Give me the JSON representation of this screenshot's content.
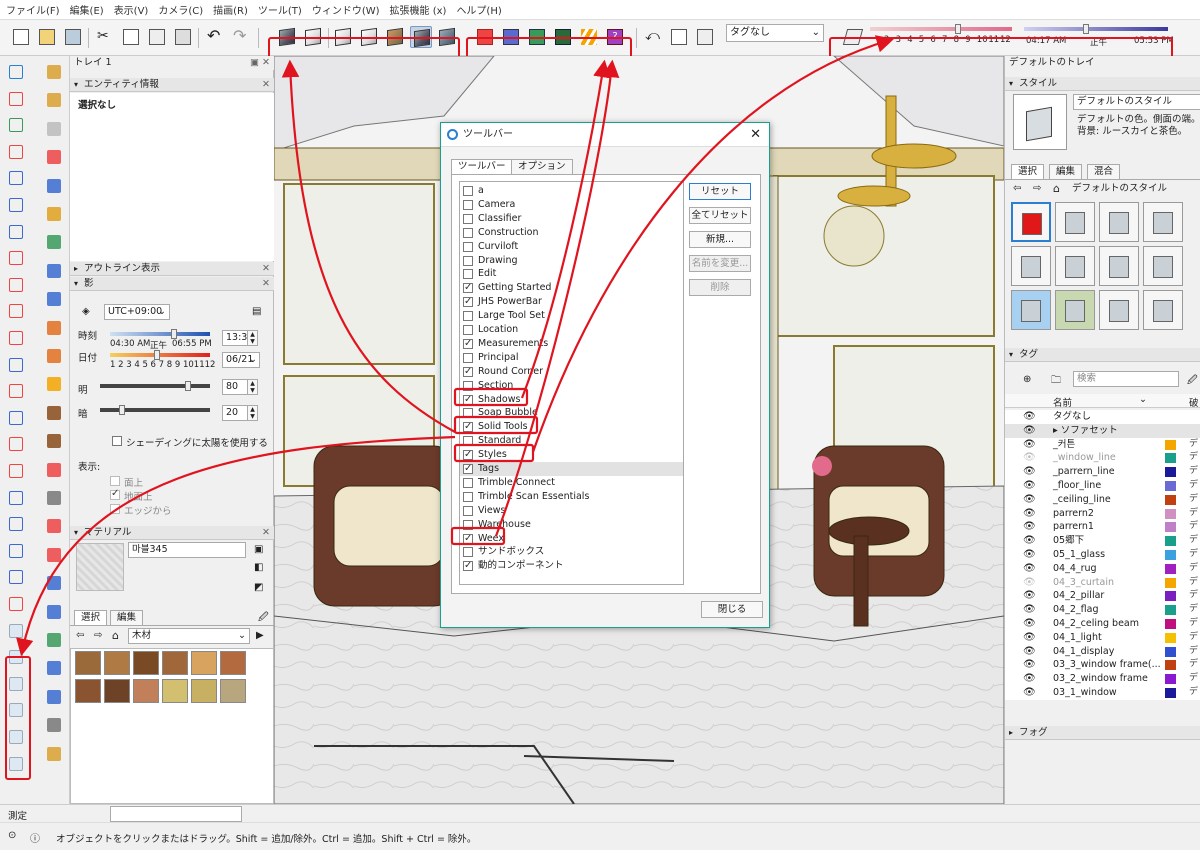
{
  "menu": [
    "ファイル(F)",
    "編集(E)",
    "表示(V)",
    "カメラ(C)",
    "描画(R)",
    "ツール(T)",
    "ウィンドウ(W)",
    "拡張機能 (x)",
    "ヘルプ(H)"
  ],
  "toolbar": {
    "tag_dropdown": "タグなし",
    "months": [
      "2",
      "3",
      "4",
      "5",
      "6",
      "7",
      "8",
      "9",
      "10",
      "11",
      "12"
    ],
    "time_start": "04:17 AM",
    "time_noon": "正午",
    "time_end": "05:53 PM"
  },
  "tray": {
    "title": "トレイ 1",
    "entity_info": {
      "header": "エンティティ情報",
      "selection": "選択なし"
    },
    "outliner": {
      "header": "アウトライン表示"
    },
    "shadows": {
      "header": "影",
      "timezone": "UTC+09:00",
      "time_label": "時刻",
      "time_start": "04:30 AM",
      "time_noon": "正午",
      "time_end": "06:55 PM",
      "time_value": "13:30",
      "date_label": "日付",
      "date_months": "1 2 3 4 5 6 7 8 9 101112",
      "date_value": "06/21",
      "light_label": "明",
      "light_value": "80",
      "light_level": 80,
      "dark_label": "暗",
      "dark_value": "20",
      "dark_level": 20,
      "use_sun_for_shading": "シェーディングに太陽を使用する",
      "display_label": "表示:",
      "on_faces": "面上",
      "on_ground": "地面上",
      "from_edges": "エッジから"
    },
    "materials": {
      "header": "マテリアル",
      "name": "마블345",
      "tab_select": "選択",
      "tab_edit": "編集",
      "library": "木材",
      "swatches": [
        "#9b6a3a",
        "#b07a44",
        "#7a4a24",
        "#a0683a",
        "#d7a35e",
        "#b26a3e",
        "#8a5430",
        "#6e4226",
        "#c2805a",
        "#d2c070",
        "#c8b062",
        "#b8a77e"
      ]
    }
  },
  "dialog": {
    "title": "ツールバー",
    "tab_toolbars": "ツールバー",
    "tab_options": "オプション",
    "items": [
      {
        "label": "a",
        "checked": false
      },
      {
        "label": "Camera",
        "checked": false
      },
      {
        "label": "Classifier",
        "checked": false
      },
      {
        "label": "Construction",
        "checked": false
      },
      {
        "label": "Curviloft",
        "checked": false
      },
      {
        "label": "Drawing",
        "checked": false
      },
      {
        "label": "Edit",
        "checked": false
      },
      {
        "label": "Getting Started",
        "checked": true
      },
      {
        "label": "JHS PowerBar",
        "checked": true
      },
      {
        "label": "Large Tool Set",
        "checked": false
      },
      {
        "label": "Location",
        "checked": false
      },
      {
        "label": "Measurements",
        "checked": true
      },
      {
        "label": "Principal",
        "checked": false
      },
      {
        "label": "Round Corner",
        "checked": true
      },
      {
        "label": "Section",
        "checked": false
      },
      {
        "label": "Shadows",
        "checked": true
      },
      {
        "label": "Soap Bubble",
        "checked": false
      },
      {
        "label": "Solid Tools",
        "checked": true
      },
      {
        "label": "Standard",
        "checked": false
      },
      {
        "label": "Styles",
        "checked": true
      },
      {
        "label": "Tags",
        "checked": true
      },
      {
        "label": "Trimble Connect",
        "checked": false
      },
      {
        "label": "Trimble Scan Essentials",
        "checked": false
      },
      {
        "label": "Views",
        "checked": false
      },
      {
        "label": "Warehouse",
        "checked": false
      },
      {
        "label": "Weex",
        "checked": true
      },
      {
        "label": "サンドボックス",
        "checked": false
      },
      {
        "label": "動的コンポーネント",
        "checked": true
      }
    ],
    "buttons": {
      "reset": "リセット",
      "reset_all": "全てリセット",
      "new": "新規...",
      "rename": "名前を変更...",
      "delete": "削除",
      "close": "閉じる"
    }
  },
  "right_tray": {
    "title": "デフォルトのトレイ",
    "styles": {
      "header": "スタイル",
      "name": "デフォルトのスタイル",
      "desc": "デフォルトの色。側面の端。背景: ルースカイと茶色。",
      "tab_select": "選択",
      "tab_edit": "編集",
      "tab_mix": "混合",
      "current": "デフォルトのスタイル"
    },
    "tags": {
      "header": "タグ",
      "search_placeholder": "検索",
      "col_name": "名前",
      "col_dash": "破",
      "rows": [
        {
          "name": "タグなし",
          "color": "",
          "vis": true,
          "dash": ""
        },
        {
          "name": "▸ ソファセット",
          "color": "",
          "vis": true,
          "dash": ""
        },
        {
          "name": "_커튼",
          "color": "#f5a500",
          "vis": true,
          "dash": "デ"
        },
        {
          "name": "_window_line",
          "color": "#1aa08a",
          "vis": false,
          "dash": "デ"
        },
        {
          "name": "_parrern_line",
          "color": "#1a1a9a",
          "vis": true,
          "dash": "デ"
        },
        {
          "name": "_floor_line",
          "color": "#6a6ad2",
          "vis": true,
          "dash": "デ"
        },
        {
          "name": "_ceiling_line",
          "color": "#c04010",
          "vis": true,
          "dash": "デ"
        },
        {
          "name": "parrern2",
          "color": "#d090c0",
          "vis": true,
          "dash": "デ"
        },
        {
          "name": "parrern1",
          "color": "#c080c8",
          "vis": true,
          "dash": "デ"
        },
        {
          "name": "05郷下",
          "color": "#1aa08a",
          "vis": true,
          "dash": "デ"
        },
        {
          "name": "05_1_glass",
          "color": "#3aa0e0",
          "vis": true,
          "dash": "デ"
        },
        {
          "name": "04_4_rug",
          "color": "#a020c0",
          "vis": true,
          "dash": "デ"
        },
        {
          "name": "04_3_curtain",
          "color": "#f5a500",
          "vis": false,
          "dash": "デ"
        },
        {
          "name": "04_2_pillar",
          "color": "#7a20c0",
          "vis": true,
          "dash": "デ"
        },
        {
          "name": "04_2_flag",
          "color": "#1aa08a",
          "vis": true,
          "dash": "デ"
        },
        {
          "name": "04_2_celing beam",
          "color": "#c01080",
          "vis": true,
          "dash": "デ"
        },
        {
          "name": "04_1_light",
          "color": "#f5c000",
          "vis": true,
          "dash": "デ"
        },
        {
          "name": "04_1_display",
          "color": "#3050d0",
          "vis": true,
          "dash": "デ"
        },
        {
          "name": "03_3_window frame(...",
          "color": "#c04010",
          "vis": true,
          "dash": "デ"
        },
        {
          "name": "03_2_window frame",
          "color": "#8a1ad0",
          "vis": true,
          "dash": "デ"
        },
        {
          "name": "03_1_window",
          "color": "#1a1a9a",
          "vis": true,
          "dash": "デ"
        }
      ]
    },
    "fog": {
      "header": "フォグ"
    }
  },
  "measurements": {
    "label": "測定",
    "value": ""
  },
  "statusbar": {
    "text": "オブジェクトをクリックまたはドラッグ。Shift = 追加/除外。Ctrl = 追加。Shift + Ctrl = 除外。"
  }
}
